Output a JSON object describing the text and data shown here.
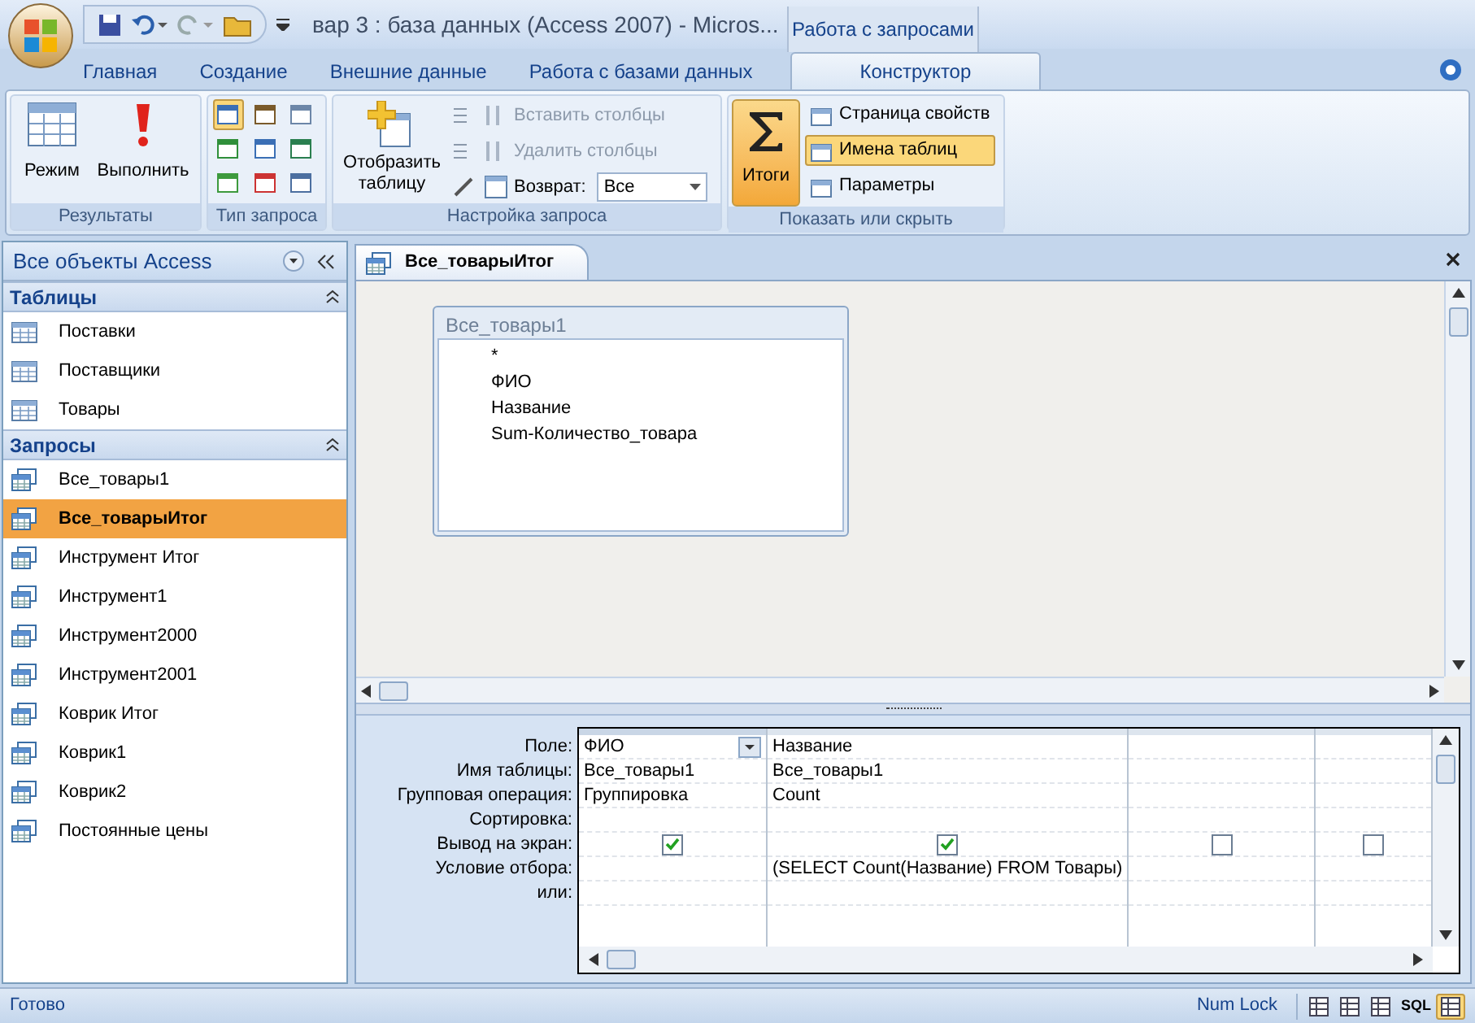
{
  "window": {
    "title": "вар 3 : база данных (Access 2007) - Micros...",
    "context_group": "Работа с запросами"
  },
  "ribbon_tabs": [
    {
      "label": "Главная",
      "selected": false
    },
    {
      "label": "Создание",
      "selected": false
    },
    {
      "label": "Внешние данные",
      "selected": false
    },
    {
      "label": "Работа с базами данных",
      "selected": false
    },
    {
      "label": "Конструктор",
      "selected": true
    }
  ],
  "ribbon": {
    "results": {
      "title": "Результаты",
      "mode": "Режим",
      "run": "Выполнить"
    },
    "query_type": {
      "title": "Тип запроса",
      "types": [
        {
          "selected": true
        },
        {
          "selected": false
        },
        {
          "selected": false
        },
        {
          "selected": false
        },
        {
          "selected": false
        },
        {
          "selected": false
        },
        {
          "selected": false
        },
        {
          "selected": false
        },
        {
          "selected": false
        }
      ]
    },
    "setup": {
      "title": "Настройка запроса",
      "show_table": "Отобразить таблицу",
      "insert_columns": {
        "label": "Вставить столбцы",
        "disabled": true
      },
      "delete_columns": {
        "label": "Удалить столбцы",
        "disabled": true
      },
      "return_label": "Возврат:",
      "return_value": "Все"
    },
    "show_hide": {
      "title": "Показать или скрыть",
      "totals": {
        "label": "Итоги",
        "selected": true
      },
      "items": [
        {
          "label": "Страница свойств",
          "selected": false
        },
        {
          "label": "Имена таблиц",
          "selected": true
        },
        {
          "label": "Параметры",
          "selected": false
        }
      ]
    }
  },
  "nav": {
    "header": "Все объекты Access",
    "groups": [
      {
        "title": "Таблицы",
        "kind": "table",
        "items": [
          {
            "label": "Поставки",
            "selected": false
          },
          {
            "label": "Поставщики",
            "selected": false
          },
          {
            "label": "Товары",
            "selected": false
          }
        ]
      },
      {
        "title": "Запросы",
        "kind": "query",
        "items": [
          {
            "label": "Все_товары1",
            "selected": false
          },
          {
            "label": "Все_товарыИтог",
            "selected": true
          },
          {
            "label": "Инструмент Итог",
            "selected": false
          },
          {
            "label": "Инструмент1",
            "selected": false
          },
          {
            "label": "Инструмент2000",
            "selected": false
          },
          {
            "label": "Инструмент2001",
            "selected": false
          },
          {
            "label": "Коврик Итог",
            "selected": false
          },
          {
            "label": "Коврик1",
            "selected": false
          },
          {
            "label": "Коврик2",
            "selected": false
          },
          {
            "label": "Постоянные цены",
            "selected": false
          }
        ]
      }
    ]
  },
  "document_tab": "Все_товарыИтог",
  "table_box": {
    "title": "Все_товары1",
    "fields": [
      "*",
      "ФИО",
      "Название",
      "Sum-Количество_товара"
    ]
  },
  "grid": {
    "row_labels": [
      "Поле:",
      "Имя таблицы:",
      "Групповая операция:",
      "Сортировка:",
      "Вывод на экран:",
      "Условие отбора:",
      "или:"
    ],
    "columns": [
      {
        "field": "ФИО",
        "table": "Все_товары1",
        "group_op": "Группировка",
        "show": true,
        "active": true
      },
      {
        "field": "Название",
        "table": "Все_товары1",
        "group_op": "Count",
        "show": true,
        "criteria": "(SELECT Count(Название) FROM Товары)",
        "active": false
      },
      {
        "show": false,
        "active": false
      },
      {
        "show": false,
        "active": false
      }
    ]
  },
  "status_bar": {
    "text": "Готово",
    "num_lock": "Num Lock",
    "views": [
      {
        "selected": false
      },
      {
        "selected": false
      },
      {
        "selected": false
      },
      {
        "label": "SQL",
        "selected": false
      },
      {
        "selected": true
      }
    ]
  }
}
